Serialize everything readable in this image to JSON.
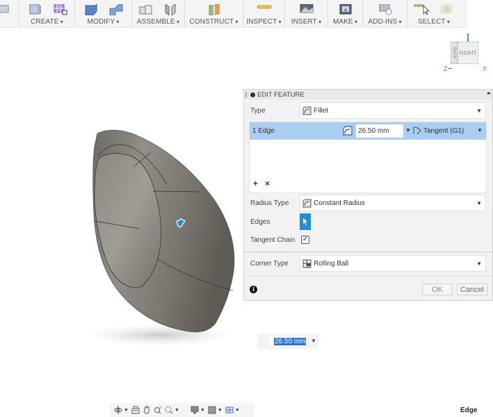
{
  "toolbar": {
    "groups": [
      {
        "label": "CREATE",
        "icons": [
          "new-component-icon",
          "create-form-icon"
        ]
      },
      {
        "label": "MODIFY",
        "icons": [
          "press-pull-icon",
          "fillet-icon"
        ]
      },
      {
        "label": "ASSEMBLE",
        "icons": [
          "new-component-icon",
          "joint-icon"
        ]
      },
      {
        "label": "CONSTRUCT",
        "icons": [
          "offset-plane-icon"
        ]
      },
      {
        "label": "INSPECT",
        "icons": [
          "measure-icon"
        ]
      },
      {
        "label": "INSERT",
        "icons": [
          "insert-image-icon"
        ]
      },
      {
        "label": "MAKE",
        "icons": [
          "3d-print-icon"
        ]
      },
      {
        "label": "ADD-INS",
        "icons": [
          "scripts-addins-icon"
        ]
      },
      {
        "label": "SELECT",
        "icons": [
          "select-cursor-icon",
          "selection-filter-icon"
        ]
      }
    ]
  },
  "viewcube": {
    "face_front": "RIGHT",
    "face_side": "BACK",
    "axis_z": "Z",
    "axis_x": "X",
    "axis_y_color": "#41b36b",
    "axis_z_color": "#5a62c8",
    "axis_x_color": "#e06565"
  },
  "panel": {
    "title": "EDIT FEATURE",
    "type": {
      "label": "Type",
      "value": "Fillet"
    },
    "edge_set": {
      "label": "1 Edge",
      "radius": "26.50 mm",
      "continuity": "Tangent (G1)"
    },
    "add_label": "+",
    "remove_label": "×",
    "radius_type": {
      "label": "Radius Type",
      "value": "Constant Radius"
    },
    "edges": {
      "label": "Edges"
    },
    "tangent_chain": {
      "label": "Tangent Chain",
      "checked": true,
      "mark": "✓"
    },
    "corner_type": {
      "label": "Corner Type",
      "value": "Rolling Ball"
    },
    "info_glyph": "i",
    "ok_label": "OK",
    "cancel_label": "Cancel"
  },
  "canvas_input": {
    "value": "26.50 mm"
  },
  "navbar": {
    "items": [
      "orbit-icon",
      "look-at-icon",
      "pan-icon",
      "zoom-icon",
      "fit-icon",
      "display-settings-icon",
      "grid-icon",
      "viewports-icon"
    ]
  },
  "status": {
    "text": "Edge"
  },
  "colors": {
    "accent": "#1e8fd6",
    "selection_row": "#aacdf2",
    "model_body": "#7f7c74"
  }
}
